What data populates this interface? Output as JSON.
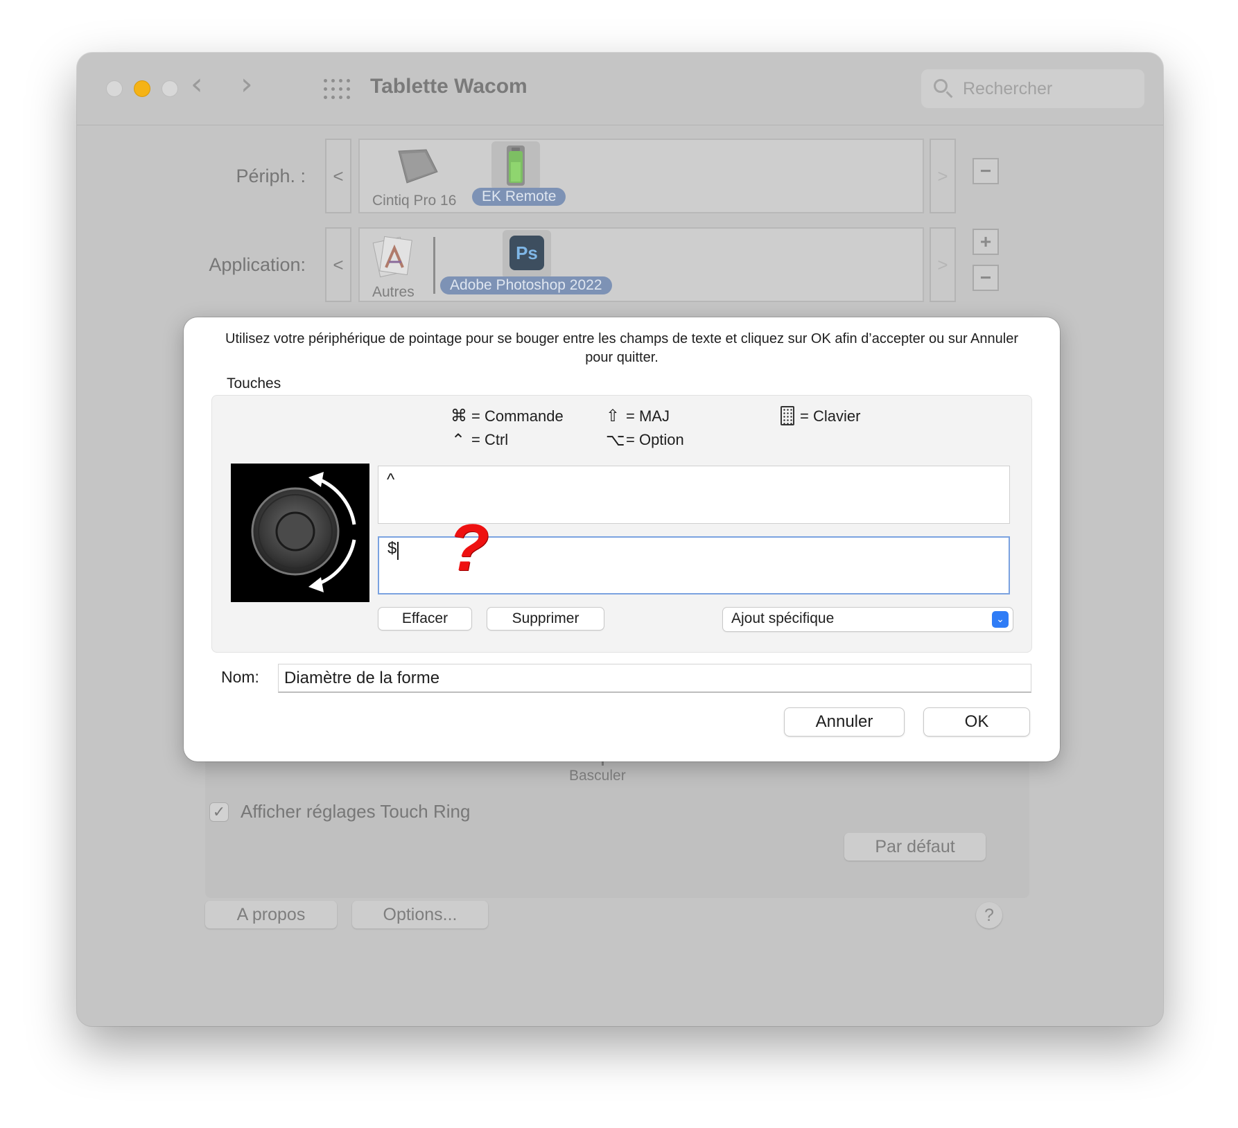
{
  "window": {
    "title": "Tablette Wacom",
    "search_placeholder": "Rechercher"
  },
  "devices": {
    "label": "Périph. :",
    "prev": "<",
    "next": ">",
    "items": [
      {
        "label": "Cintiq Pro 16",
        "selected": false
      },
      {
        "label": "EK Remote",
        "selected": true
      }
    ],
    "remove": "−"
  },
  "applications": {
    "label": "Application:",
    "prev": "<",
    "next": ">",
    "items": [
      {
        "label": "Autres",
        "selected": false
      },
      {
        "label": "Adobe Photoshop 2022",
        "selected": true,
        "icon_text": "Ps"
      }
    ],
    "add": "+",
    "remove": "−"
  },
  "background": {
    "basculer": "Basculer",
    "show_settings_label": "Afficher réglages Touch Ring",
    "show_settings_checked": true,
    "default_button": "Par défaut",
    "about_button": "A propos",
    "options_button": "Options...",
    "help_button": "?"
  },
  "dialog": {
    "instructions": "Utilisez votre périphérique de pointage pour se bouger entre les champs de texte et cliquez sur OK afin d’accepter ou sur Annuler pour quitter.",
    "group_label": "Touches",
    "legend": {
      "command": "= Commande",
      "ctrl": "= Ctrl",
      "shift": "= MAJ",
      "option": "= Option",
      "keyboard": "= Clavier"
    },
    "field_clockwise": "^",
    "field_counterclockwise": "$",
    "annotation": "?",
    "clear_button": "Effacer",
    "delete_button": "Supprimer",
    "special_add": "Ajout spécifique",
    "name_label": "Nom:",
    "name_value": "Diamètre de la forme",
    "cancel_button": "Annuler",
    "ok_button": "OK"
  },
  "colors": {
    "accent": "#2f7cf6",
    "selection_pill": "#7d92b5",
    "minimize": "#f5b316",
    "annotation": "#ee1111"
  }
}
